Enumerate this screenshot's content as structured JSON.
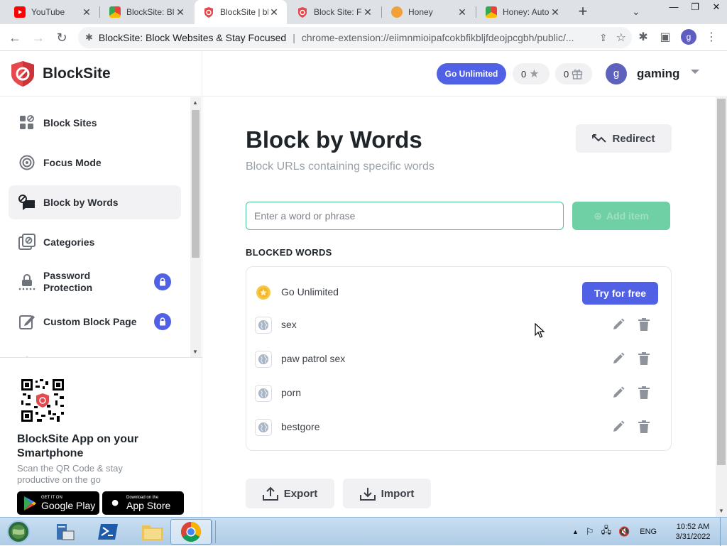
{
  "browser": {
    "tabs": [
      {
        "title": "YouTube",
        "favicon": "youtube-icon"
      },
      {
        "title": "BlockSite: Bl",
        "favicon": "chrome-store-icon"
      },
      {
        "title": "BlockSite | bl",
        "favicon": "blocksite-icon",
        "active": true
      },
      {
        "title": "Block Site: Fo",
        "favicon": "blocksite-icon"
      },
      {
        "title": "Honey",
        "favicon": "honey-icon"
      },
      {
        "title": "Honey: Auto",
        "favicon": "chrome-store-icon"
      }
    ],
    "omnibox": {
      "site_label": "BlockSite: Block Websites & Stay Focused",
      "separator": "|",
      "url": "chrome-extension://eiimnmioipafcokbfikbljfdeojpcgbh/public/..."
    },
    "profile_initial": "g"
  },
  "app": {
    "brand": "BlockSite",
    "go_unlimited": "Go Unlimited",
    "stars_count": "0",
    "gifts_count": "0",
    "user_initial": "g",
    "user_name": "gaming",
    "accent_color": "#5161e6",
    "green_color": "#4bc494"
  },
  "sidebar": {
    "items": [
      {
        "label": "Block Sites",
        "icon": "grid-icon"
      },
      {
        "label": "Focus Mode",
        "icon": "target-icon"
      },
      {
        "label": "Block by Words",
        "icon": "block-words-icon",
        "active": true
      },
      {
        "label": "Categories",
        "icon": "categories-icon"
      },
      {
        "label": "Password Protection",
        "icon": "password-icon",
        "locked": true
      },
      {
        "label": "Custom Block Page",
        "icon": "edit-page-icon",
        "locked": true
      }
    ],
    "promo": {
      "title": "BlockSite App on your Smartphone",
      "subtitle": "Scan the QR Code & stay productive on the go",
      "google_small": "GET IT ON",
      "google_big": "Google Play",
      "apple_small": "Download on the",
      "apple_big": "App Store"
    }
  },
  "main": {
    "title": "Block by Words",
    "subtitle": "Block URLs containing specific words",
    "redirect_label": "Redirect",
    "input_placeholder": "Enter a word or phrase",
    "add_label": "Add item",
    "section_label": "BLOCKED WORDS",
    "upsell": {
      "label": "Go Unlimited",
      "button": "Try for free"
    },
    "blocked_words": [
      "sex",
      "paw patrol sex",
      "porn",
      "bestgore"
    ],
    "export_label": "Export",
    "import_label": "Import"
  },
  "taskbar": {
    "language": "ENG",
    "time": "10:52 AM",
    "date": "3/31/2022"
  }
}
